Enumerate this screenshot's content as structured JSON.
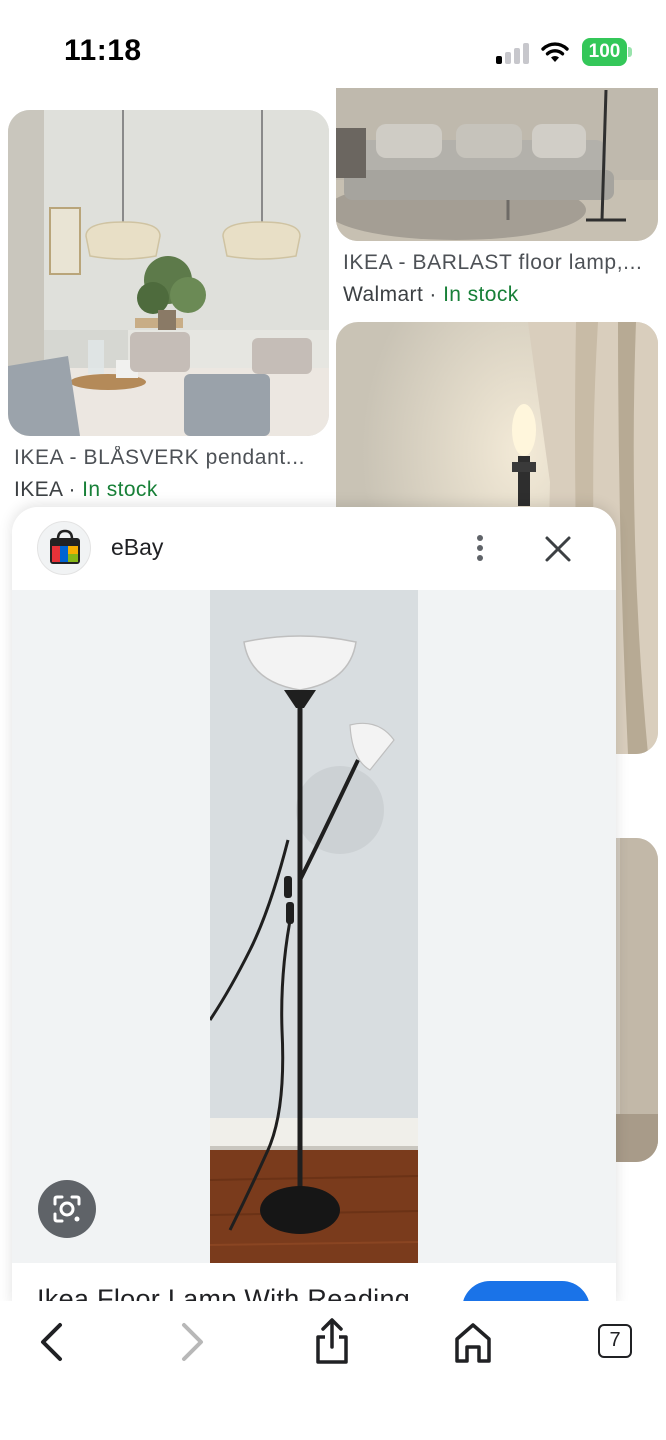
{
  "status_bar": {
    "time": "11:18",
    "battery_percent": "100",
    "signal_bars_active": 1,
    "battery_color": "#34c759"
  },
  "results": {
    "left": {
      "title": "IKEA - BLÅSVERK pendant...",
      "source": "IKEA",
      "separator": " · ",
      "stock": "In stock"
    },
    "right": {
      "title": "IKEA - BARLAST floor lamp,...",
      "source": "Walmart",
      "separator": " · ",
      "stock": "In stock"
    },
    "stock_color": "#188038"
  },
  "preview_sheet": {
    "site_name": "eBay",
    "site_logo_icon": "shopping-bag-icon",
    "menu_icon": "more-vert-icon",
    "close_icon": "close-icon",
    "lens_icon": "google-lens-icon",
    "product_title": "Ikea Floor Lamp With Reading",
    "action_button_color": "#1a73e8"
  },
  "toolbar": {
    "back_icon": "chevron-left-icon",
    "forward_icon": "chevron-right-icon",
    "share_icon": "share-icon",
    "home_icon": "home-icon",
    "tabs_count": "7"
  }
}
